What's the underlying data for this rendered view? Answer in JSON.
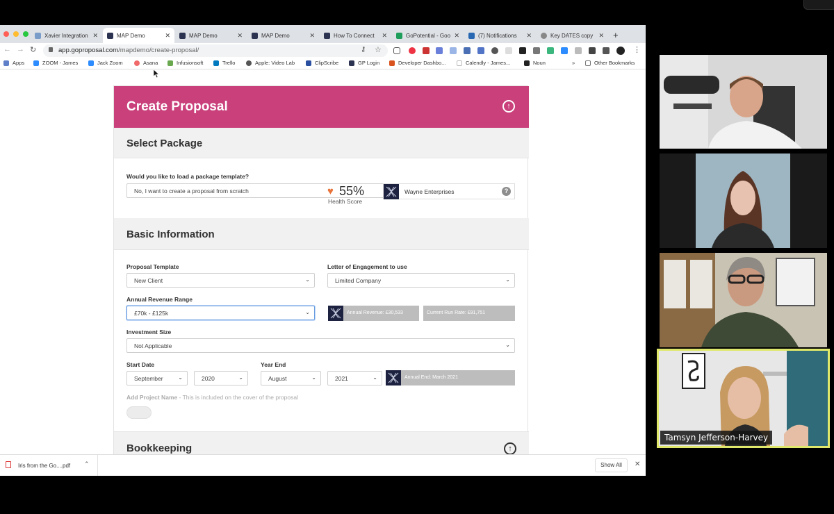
{
  "browser": {
    "tabs": [
      {
        "label": "Xavier Integration",
        "active": false,
        "icon": "xavier-favicon",
        "color": "#7a9cc8"
      },
      {
        "label": "MAP Demo",
        "active": true,
        "icon": "map-favicon",
        "color": "#2b3350"
      },
      {
        "label": "MAP Demo",
        "active": false,
        "icon": "map-favicon",
        "color": "#2b3350"
      },
      {
        "label": "MAP Demo",
        "active": false,
        "icon": "map-favicon",
        "color": "#2b3350"
      },
      {
        "label": "How To Connect",
        "active": false,
        "icon": "map-favicon",
        "color": "#2b3350"
      },
      {
        "label": "GoPotential - Goo",
        "active": false,
        "icon": "sheets-favicon",
        "color": "#1e9e5a"
      },
      {
        "label": "(7) Notifications",
        "active": false,
        "icon": "linkedin-favicon",
        "color": "#2867b2"
      },
      {
        "label": "Key DATES copy",
        "active": false,
        "icon": "globe-favicon",
        "color": "#888888"
      }
    ],
    "url_host": "app.goproposal.com",
    "url_path": "/mapdemo/create-proposal/",
    "bookmarks": [
      {
        "label": "Apps",
        "color": "#5f7fc9"
      },
      {
        "label": "ZOOM - James",
        "color": "#2d8cff"
      },
      {
        "label": "Jack Zoom",
        "color": "#2d8cff"
      },
      {
        "label": "Asana",
        "color": "#f06a6a"
      },
      {
        "label": "Infusionsoft",
        "color": "#6aa84f"
      },
      {
        "label": "Trello",
        "color": "#0079bf"
      },
      {
        "label": "Apple: Video Lab",
        "color": "#555555"
      },
      {
        "label": "ClipScribe",
        "color": "#2b4fa0"
      },
      {
        "label": "GP Login",
        "color": "#2b3350"
      },
      {
        "label": "Developer Dashbo...",
        "color": "#d9531e"
      },
      {
        "label": "Calendly - James...",
        "color": "#cccccc"
      },
      {
        "label": "Noun",
        "color": "#222222"
      }
    ],
    "bookmarks_more": "»",
    "other_bookmarks": "Other Bookmarks"
  },
  "proposal": {
    "title": "Create Proposal",
    "select_package": {
      "heading": "Select Package",
      "question": "Would you like to load a package template?",
      "value": "No, I want to create a proposal from scratch"
    },
    "basic_info": {
      "heading": "Basic Information",
      "health_pct": "55%",
      "health_label": "Health Score",
      "client_name": "Wayne Enterprises",
      "help": "?",
      "proposal_template_label": "Proposal Template",
      "proposal_template_value": "New Client",
      "letter_label": "Letter of Engagement to use",
      "letter_value": "Limited Company",
      "revenue_label": "Annual Revenue Range",
      "revenue_value": "£70k - £125k",
      "annual_revenue": "Annual Revenue: £30,533",
      "run_rate": "Current Run Rate: £91,751",
      "investment_label": "Investment Size",
      "investment_value": "Not Applicable",
      "start_date_label": "Start Date",
      "start_month": "September",
      "start_year": "2020",
      "year_end_label": "Year End",
      "end_month": "August",
      "end_year": "2021",
      "annual_end": "Annual End: March 2021",
      "project_name_label": "Add Project Name",
      "project_name_hint": " - This is included on the cover of the proposal"
    },
    "bookkeeping": {
      "heading": "Bookkeeping"
    }
  },
  "downloads": {
    "file": "Iris from the Go....pdf",
    "show_all": "Show All"
  },
  "participants": {
    "active_speaker": "Tamsyn Jefferson-Harvey"
  },
  "colors": {
    "brand_pink": "#c9407b",
    "speaker_highlight": "#dfe86a"
  }
}
